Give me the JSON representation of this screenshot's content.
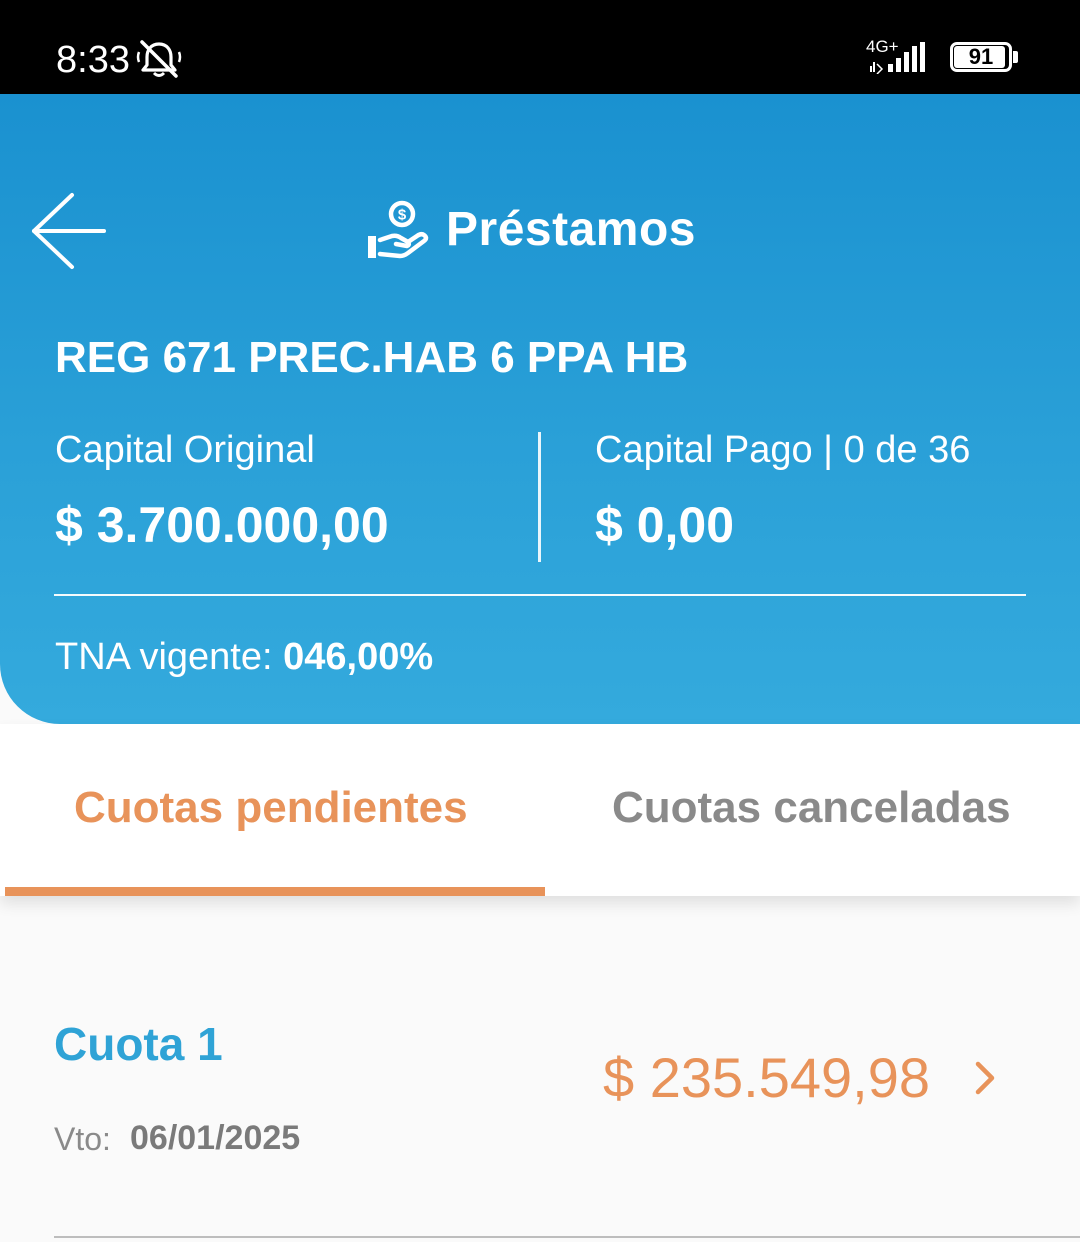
{
  "status_bar": {
    "time": "8:33",
    "network": "4G+",
    "battery": "91",
    "icons": [
      "bell-off-icon",
      "signal-icon",
      "battery-icon"
    ]
  },
  "header": {
    "title": "Préstamos",
    "back_icon": "arrow-left-icon",
    "title_icon": "hand-money-icon"
  },
  "loan": {
    "name": "REG 671 PREC.HAB 6 PPA HB",
    "capital_original_label": "Capital Original",
    "capital_original_value": "$ 3.700.000,00",
    "capital_pago_label": "Capital Pago | 0 de 36",
    "capital_pago_value": "$ 0,00",
    "tna_label": "TNA vigente:",
    "tna_value": "046,00%"
  },
  "tabs": [
    {
      "label": "Cuotas pendientes",
      "active": true
    },
    {
      "label": "Cuotas canceladas",
      "active": false
    }
  ],
  "installments": [
    {
      "title": "Cuota 1",
      "due_label": "Vto:",
      "due_date": "06/01/2025",
      "amount": "$ 235.549,98",
      "icon": "chevron-right-icon"
    }
  ],
  "colors": {
    "header_blue": "#1a91d0",
    "accent_orange": "#e8935a",
    "title_blue": "#2fa3d6",
    "muted_gray": "#8a8a8a"
  }
}
